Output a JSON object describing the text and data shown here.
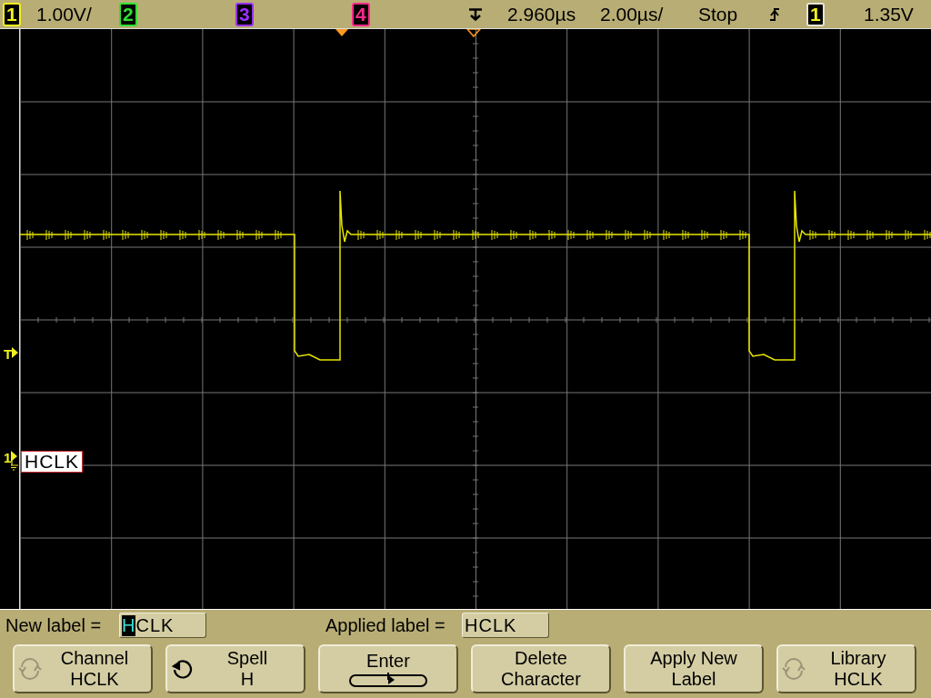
{
  "top_bar": {
    "channels": [
      {
        "number": "1",
        "color": "#f0f020",
        "scale": "1.00V/"
      },
      {
        "number": "2",
        "color": "#30e030"
      },
      {
        "number": "3",
        "color": "#9a30ff"
      },
      {
        "number": "4",
        "color": "#ff2a8a"
      }
    ],
    "delay": "2.960µs",
    "timebase": "2.00µs/",
    "run_state": "Stop",
    "trigger_source": "1",
    "trigger_level": "1.35V"
  },
  "display": {
    "trigger_marker": "T",
    "ground_marker": "1",
    "channel_label": "HCLK"
  },
  "label_bar": {
    "new_label": {
      "caption": "New label =",
      "segments": [
        {
          "text": "H",
          "selected": true
        },
        {
          "text": "CLK",
          "selected": false
        }
      ]
    },
    "applied_label": {
      "caption": "Applied label =",
      "value": "HCLK"
    }
  },
  "softkeys": [
    {
      "kind": "knob",
      "label": "Channel",
      "value": "HCLK",
      "disabled": true
    },
    {
      "kind": "knob",
      "label": "Spell",
      "value": "H",
      "disabled": false
    },
    {
      "kind": "enter",
      "label": "Enter"
    },
    {
      "kind": "text",
      "label": "Delete\nCharacter"
    },
    {
      "kind": "text",
      "label": "Apply New\nLabel"
    },
    {
      "kind": "knob",
      "label": "Library",
      "value": "HCLK",
      "disabled": true
    }
  ]
}
